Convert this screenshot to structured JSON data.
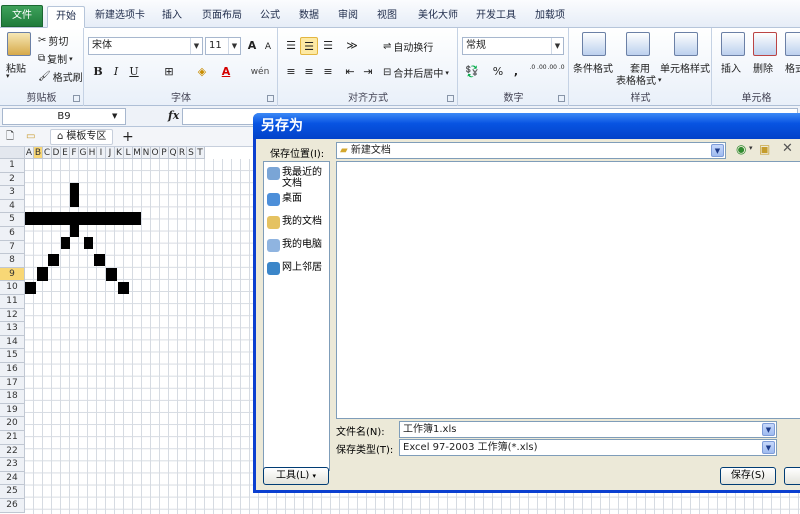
{
  "ribbon_tabs": [
    "文件",
    "开始",
    "新建选项卡",
    "插入",
    "页面布局",
    "公式",
    "数据",
    "审阅",
    "视图",
    "美化大师",
    "开发工具",
    "加载项"
  ],
  "clipboard": {
    "paste": "粘贴",
    "cut": "剪切",
    "copy": "复制",
    "format_painter": "格式刷",
    "group": "剪贴板"
  },
  "font": {
    "name": "宋体",
    "size": "11",
    "grow": "A",
    "shrink": "A",
    "bold": "B",
    "italic": "I",
    "underline": "U",
    "color_letter": "A",
    "phonetic": "wén",
    "group": "字体"
  },
  "alignment": {
    "wrap": "自动换行",
    "merge": "合并后居中",
    "group": "对齐方式"
  },
  "number": {
    "format": "常规",
    "percent": "%",
    "comma": ",",
    "inc_dec": ".0 .00",
    "dec_dec": ".00 .0",
    "group": "数字"
  },
  "styles": {
    "conditional": "条件格式",
    "table_l1": "套用",
    "table_l2": "表格格式",
    "cell_styles": "单元格样式",
    "group": "样式"
  },
  "cells": {
    "insert": "插入",
    "delete": "删除",
    "format": "格式",
    "group": "单元格"
  },
  "formula_bar": {
    "name_box": "B9",
    "fx": "fx",
    "formula": ""
  },
  "sheet_tabs": {
    "template_zone": "模板专区",
    "add": "+"
  },
  "columns": [
    "A",
    "B",
    "C",
    "D",
    "E",
    "F",
    "G",
    "H",
    "I",
    "J",
    "K",
    "L",
    "M",
    "N",
    "O",
    "P",
    "Q",
    "R",
    "S",
    "T"
  ],
  "rows": [
    "1",
    "2",
    "3",
    "4",
    "5",
    "6",
    "7",
    "8",
    "9",
    "10",
    "11",
    "12",
    "13",
    "14",
    "15",
    "16",
    "17",
    "18",
    "19",
    "20",
    "21",
    "22",
    "23",
    "24",
    "25",
    "26"
  ],
  "selected_cell": {
    "column": "B",
    "row": "9"
  },
  "dialog": {
    "title": "另存为",
    "save_in_label": "保存位置(I):",
    "save_in_value": "新建文档",
    "places": [
      "我最近的文档",
      "桌面",
      "我的文档",
      "我的电脑",
      "网上邻居"
    ],
    "filename_label": "文件名(N):",
    "filename_value": "工作簿1.xls",
    "filetype_label": "保存类型(T):",
    "filetype_value": "Excel 97-2003 工作簿(*.xls)",
    "tools_button": "工具(L)",
    "save_button": "保存(S)"
  },
  "colors": {
    "accent": "#0b3fd0",
    "file_tab": "#2a8a48",
    "highlight": "#f8d776"
  }
}
